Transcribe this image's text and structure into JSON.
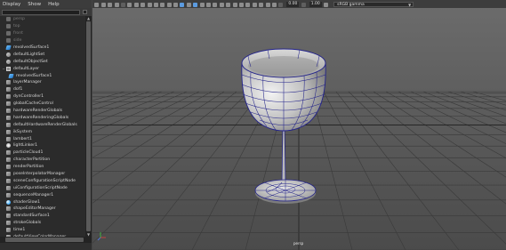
{
  "outliner": {
    "menu": [
      "Display",
      "Show",
      "Help"
    ],
    "search_placeholder": "",
    "items": [
      {
        "label": "persp",
        "icon": "camera",
        "dim": true
      },
      {
        "label": "top",
        "icon": "camera",
        "dim": true
      },
      {
        "label": "front",
        "icon": "camera",
        "dim": true
      },
      {
        "label": "side",
        "icon": "camera",
        "dim": true
      },
      {
        "label": "revolvedSurface1",
        "icon": "surface"
      },
      {
        "label": "defaultLightSet",
        "icon": "set"
      },
      {
        "label": "defaultObjectSet",
        "icon": "set"
      },
      {
        "label": "defaultLayer",
        "icon": "layer",
        "expand": "−"
      },
      {
        "label": "revolvedSurface1",
        "icon": "surface",
        "indent": true
      },
      {
        "label": "layerManager",
        "icon": "node"
      },
      {
        "label": "dof1",
        "icon": "node"
      },
      {
        "label": "dynController1",
        "icon": "node"
      },
      {
        "label": "globalCacheControl",
        "icon": "node"
      },
      {
        "label": "hardwareRenderGlobals",
        "icon": "node"
      },
      {
        "label": "hardwareRenderingGlobals",
        "icon": "node"
      },
      {
        "label": "defaultHardwareRenderGlobals",
        "icon": "node"
      },
      {
        "label": "ikSystem",
        "icon": "node"
      },
      {
        "label": "lambert1",
        "icon": "node"
      },
      {
        "label": "lightLinker1",
        "icon": "light"
      },
      {
        "label": "particleCloud1",
        "icon": "node"
      },
      {
        "label": "characterPartition",
        "icon": "node"
      },
      {
        "label": "renderPartition",
        "icon": "node"
      },
      {
        "label": "poseInterpolatorManager",
        "icon": "node"
      },
      {
        "label": "sceneConfigurationScriptNode",
        "icon": "node"
      },
      {
        "label": "uiConfigurationScriptNode",
        "icon": "node"
      },
      {
        "label": "sequenceManager1",
        "icon": "node"
      },
      {
        "label": "shaderGlow1",
        "icon": "shader"
      },
      {
        "label": "shapeEditorManager",
        "icon": "node"
      },
      {
        "label": "standardSurface1",
        "icon": "node"
      },
      {
        "label": "strokeGlobals",
        "icon": "node"
      },
      {
        "label": "time1",
        "icon": "node"
      },
      {
        "label": "defaultViewColorManager",
        "icon": "node"
      }
    ]
  },
  "viewport": {
    "toolbar": {
      "exposure": "0.00",
      "gamma": "1.00",
      "color_space": "sRGB gamma"
    },
    "camera_label": "persp",
    "axis_labels": {
      "x": "x",
      "y": "y",
      "z": "z"
    }
  }
}
